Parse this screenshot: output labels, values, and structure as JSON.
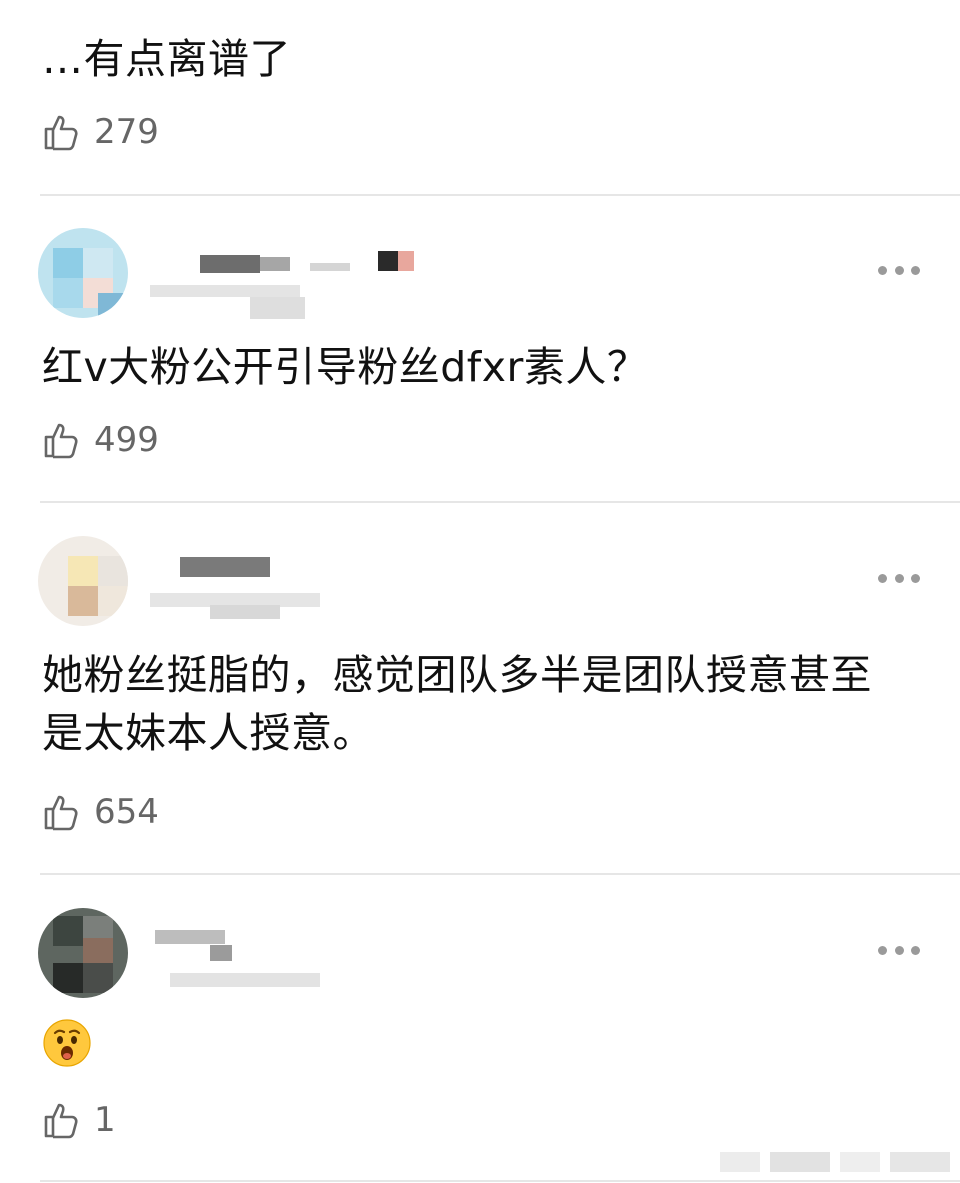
{
  "comments": [
    {
      "text": "…有点离谱了",
      "likes": "279"
    },
    {
      "text": "红v大粉公开引导粉丝dfxr素人？",
      "likes": "499"
    },
    {
      "text": "她粉丝挺脂的，感觉团队多半是团队授意甚至是太妹本人授意。",
      "likes": "654"
    },
    {
      "text": "😧",
      "likes": "1"
    }
  ],
  "icons": {
    "like": "thumbs-up-icon",
    "more": "more-dots-icon",
    "emoji": "anguished-face-emoji"
  },
  "colors": {
    "text": "#111111",
    "secondary": "#666666",
    "divider": "#e6e6e6",
    "dots": "#9a9a9a"
  }
}
